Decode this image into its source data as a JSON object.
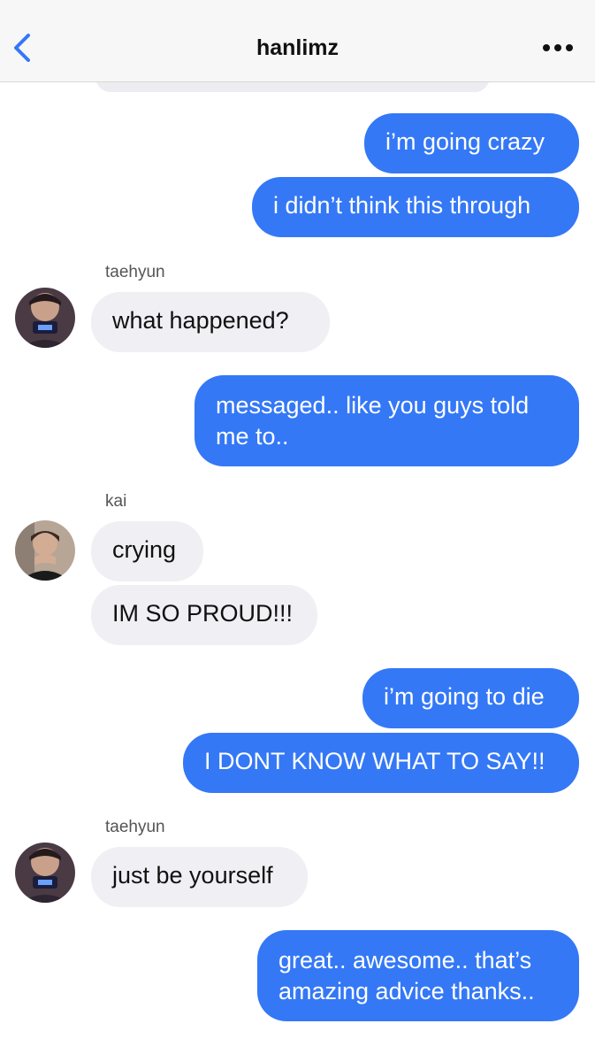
{
  "header": {
    "title": "hanlimz",
    "back_icon": "chevron-left-icon",
    "more_icon": "ellipsis-icon",
    "accent_color": "#3478f6"
  },
  "messages": [
    {
      "direction": "out",
      "text": "i’m going crazy"
    },
    {
      "direction": "out",
      "text": "i didn’t think this through"
    },
    {
      "direction": "in",
      "sender": "taehyun",
      "text": "what happened?"
    },
    {
      "direction": "out",
      "text": "messaged.. like you guys told\nme to.."
    },
    {
      "direction": "in",
      "sender": "kai",
      "text": "crying"
    },
    {
      "direction": "in",
      "sender": "kai",
      "text": "IM SO PROUD!!!"
    },
    {
      "direction": "out",
      "text": "i’m going to die"
    },
    {
      "direction": "out",
      "text": "I DONT KNOW WHAT TO SAY!!"
    },
    {
      "direction": "in",
      "sender": "taehyun",
      "text": "just be yourself"
    },
    {
      "direction": "out",
      "text": "great.. awesome.. that’s\namazing advice thanks.."
    }
  ],
  "colors": {
    "outgoing_bubble": "#3478f6",
    "incoming_bubble": "#efeff4",
    "header_bg": "#f7f7f7"
  }
}
